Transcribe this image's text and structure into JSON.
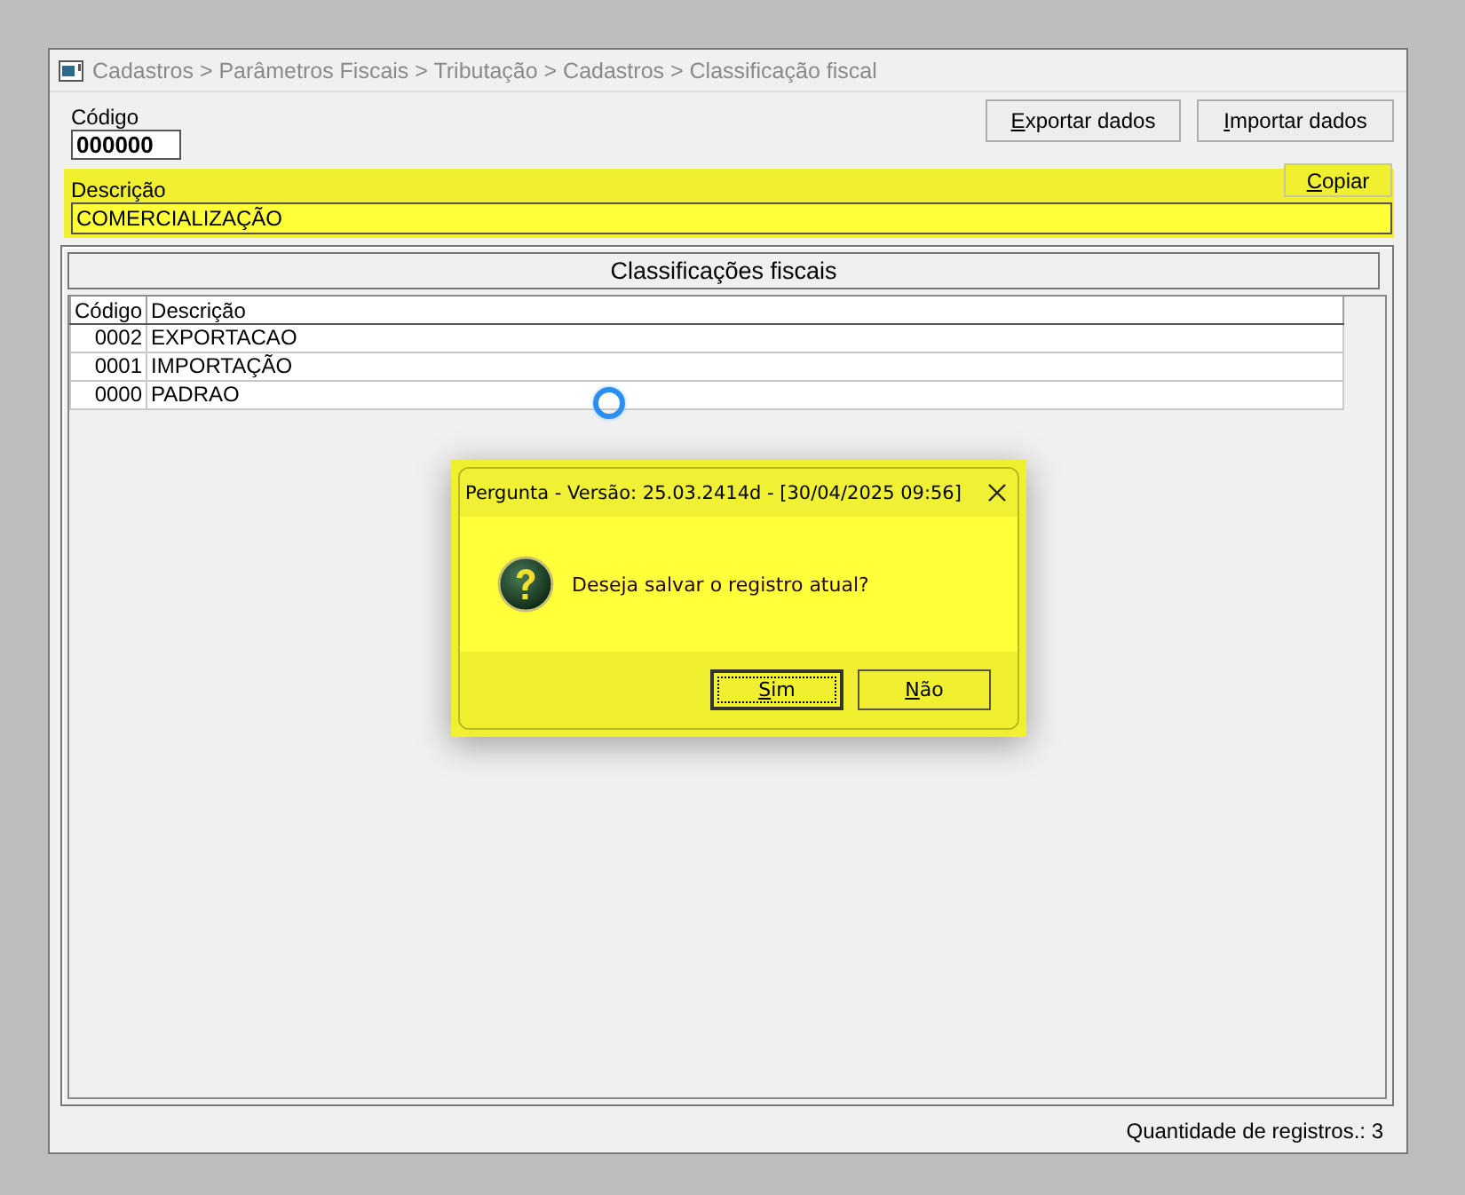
{
  "window": {
    "title": "Cadastros > Parâmetros Fiscais > Tributação > Cadastros > Classificação fiscal"
  },
  "form": {
    "code": {
      "label": "Código",
      "value": "000000"
    },
    "description": {
      "label": "Descrição",
      "value": "COMERCIALIZAÇÃO"
    }
  },
  "top_buttons": [
    "Exportar dados",
    "Importar dados"
  ],
  "copy_button": "Copiar",
  "table": {
    "title": "Classificações fiscais",
    "columns": [
      "Código",
      "Descrição"
    ],
    "rows": [
      [
        "0002",
        "EXPORTACAO"
      ],
      [
        "0001",
        "IMPORTAÇÃO"
      ],
      [
        "0000",
        "PADRAO"
      ]
    ]
  },
  "loading": true,
  "status_bar": "Quantidade de registros.: 3",
  "dialog": {
    "title": "Pergunta - Versão: 25.03.2414d - [30/04/2025 09:56]",
    "message": "Deseja salvar o registro atual?",
    "buttons": [
      {
        "label": "Sim",
        "focused": true
      },
      {
        "label": "Não",
        "focused": false
      }
    ]
  }
}
